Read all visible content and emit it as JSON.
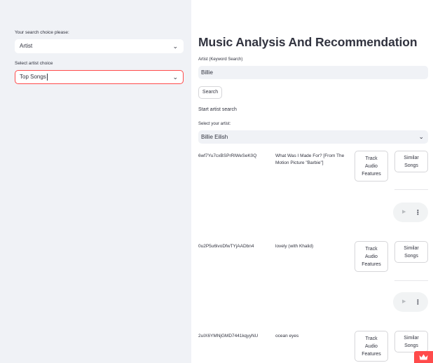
{
  "sidebar": {
    "search_choice_label": "Your search choice please:",
    "search_choice_value": "Artist",
    "artist_choice_label": "Select artist choice",
    "artist_choice_value": "Top Songs"
  },
  "main": {
    "title": "Music Analysis And Recommendation",
    "keyword_label": "Artist (Keyword Search)",
    "keyword_value": "Billie",
    "search_button": "Search",
    "start_text": "Start artist search",
    "select_artist_label": "Select your artist:",
    "select_artist_value": "Billie Eilish",
    "tracks": [
      {
        "id": "6wf7Yu7cxBSPrRlWeSeK0Q",
        "name": "What Was I Made For? [From The Motion Picture \"Barbie\"]"
      },
      {
        "id": "0u2P5u6lvoDfwTYjAADbn4",
        "name": "lovely (with Khalid)"
      },
      {
        "id": "2uIX6YMNjGMD7441kqyyNU",
        "name": "ocean eyes"
      }
    ],
    "track_button": [
      "Track",
      "Audio",
      "Features"
    ],
    "similar_button": [
      "Similar",
      "Songs"
    ],
    "play_glyph": "▶",
    "menu_glyph": "⋮",
    "chevron_glyph": "⌄"
  },
  "colors": {
    "accent": "#ff4b4b",
    "sidebar_bg": "#f0f2f6",
    "text": "#31333f"
  },
  "icons": {
    "dropdown": "chevron-down-icon",
    "play": "play-icon",
    "more": "more-vertical-icon",
    "badge": "crown-icon"
  }
}
